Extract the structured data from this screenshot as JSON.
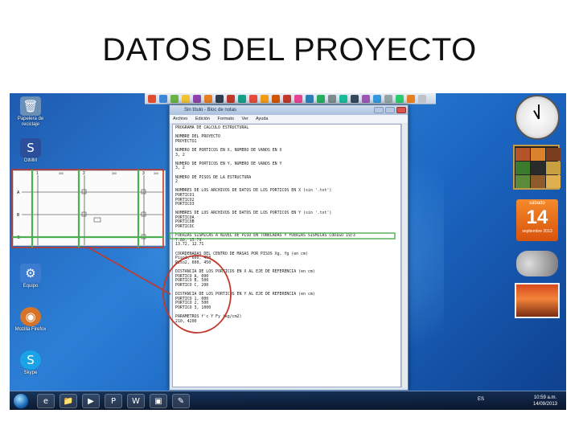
{
  "slide": {
    "title": "DATOS DEL PROYECTO"
  },
  "desktop_icons": [
    {
      "label": "Papelera de reciclaje",
      "glyph": "🗑",
      "color": "#6b8fb5"
    },
    {
      "label": "DIMM",
      "glyph": "S",
      "color": "#2b4f9a"
    },
    {
      "label": "Equipo",
      "glyph": "⚙",
      "color": "#3b7bd0"
    },
    {
      "label": "Mozilla Firefox",
      "glyph": "◉",
      "color": "#d6752a"
    },
    {
      "label": "Skype",
      "glyph": "S",
      "color": "#1aa3e6"
    }
  ],
  "notepad": {
    "title": "Sin título - Bloc de notas",
    "menu": [
      "Archivo",
      "Edición",
      "Formato",
      "Ver",
      "Ayuda"
    ],
    "lines": [
      "PROGRAMA DE CALCULO ESTRUCTURAL",
      "",
      "NOMBRE DEL PROYECTO",
      "PROYECTO1",
      "",
      "NUMERO DE PORTICOS EN X, NUMERO DE VANOS EN X",
      "3, 2",
      "",
      "NUMERO DE PORTICOS EN Y, NUMERO DE VANOS EN Y",
      "3, 2",
      "",
      "NUMERO DE PISOS DE LA ESTRUCTURA",
      "2",
      "",
      "NOMBRES DE LOS ARCHIVOS DE DATOS DE LOS PORTICOS EN X (sin '.txt')",
      "PORTICO1",
      "PORTICO2",
      "PORTICO3",
      "",
      "NOMBRES DE LOS ARCHIVOS DE DATOS DE LOS PORTICOS EN Y (sin '.txt')",
      "PORTICOA",
      "PORTICOB",
      "PORTICOC",
      "",
      "FUERZAS SISMICAS A NIVEL DE PISO EN TONELADAS Y FUERZAS SISMICAS CODIGO 19/3",
      "7.80, 15.79",
      "13.72, 12.71",
      "",
      "COORDENADAS DEL CENTRO DE MASAS POR PISOS Xg, Yg (en cm)",
      "Piso1, 600, 450",
      "Piso2, 600, 450",
      "",
      "DISTANCIA DE LOS PORTICOS EN X AL EJE DE REFERENCIA (en cm)",
      "PORTICO A, 000",
      "PORTICO B, 500",
      "PORTICO C, 200",
      "",
      "DISTANCIA DE LOS PORTICOS EN Y AL EJE DE REFERENCIA (en cm)",
      "PORTICO 1, 000",
      "PORTICO 2, 500",
      "PORTICO 3, 1000",
      "",
      "PARAMETROS f'c Y Fy (kg/cm2)",
      "210, 4200"
    ]
  },
  "drawing": {
    "axis_numbers": [
      "1",
      "2",
      "3"
    ],
    "axis_letters": [
      "A",
      "B",
      "C"
    ],
    "dims": [
      "300",
      "300",
      "300"
    ]
  },
  "calendar": {
    "day": "sábado",
    "number": "14",
    "month": "septiembre 2013"
  },
  "taskbar": {
    "apps": [
      "e",
      "📁",
      "▶",
      "P",
      "W",
      "▣",
      "✎"
    ],
    "lang": "ES",
    "time": "10:59 a.m.",
    "date": "14/09/2013"
  },
  "colors": {
    "highlight_red": "#c0392b",
    "highlight_green": "#4caf50"
  }
}
